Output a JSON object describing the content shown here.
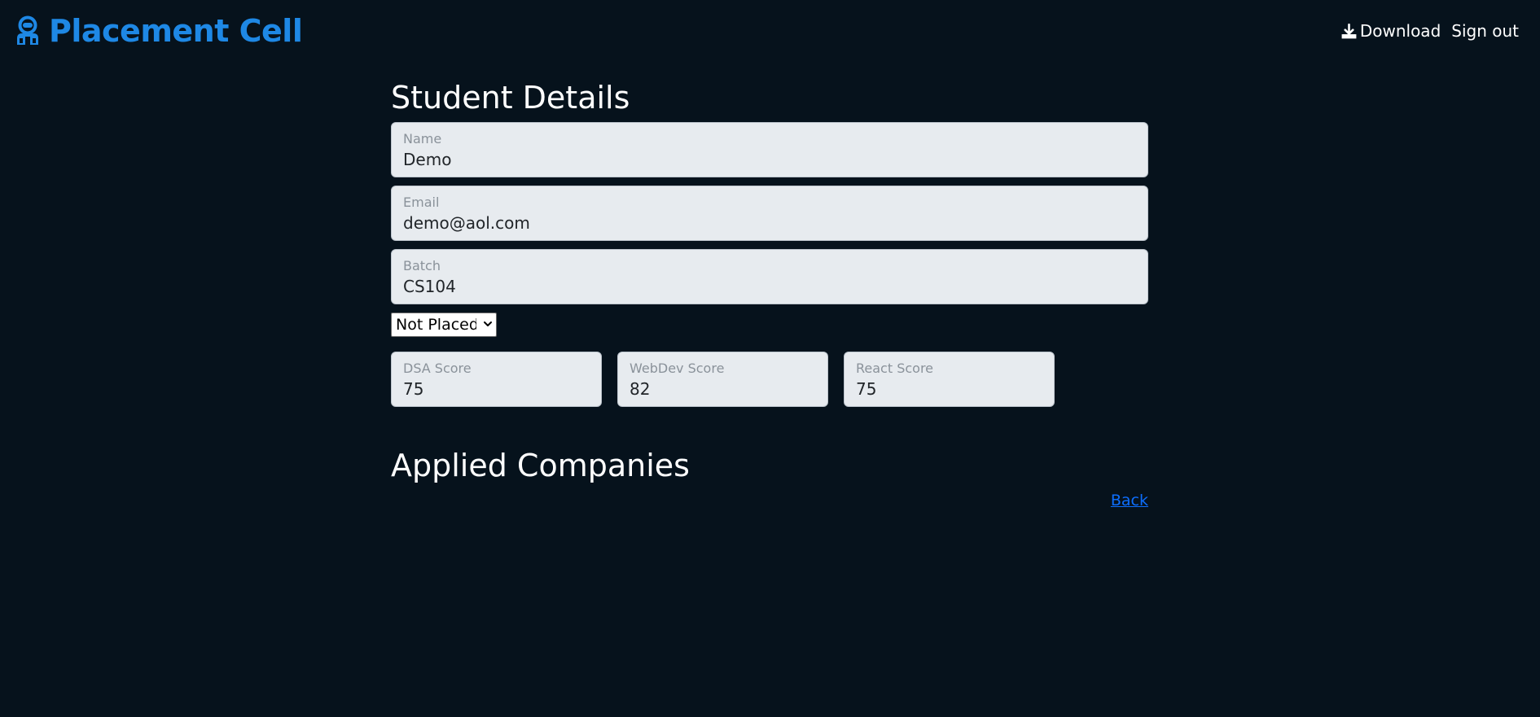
{
  "navbar": {
    "brand": "Placement Cell",
    "brand_icon": "robot-icon",
    "download_label": "Download",
    "download_icon": "download-icon",
    "signout_label": "Sign out"
  },
  "page": {
    "title": "Student Details"
  },
  "form": {
    "name": {
      "label": "Name",
      "value": "Demo"
    },
    "email": {
      "label": "Email",
      "value": "demo@aol.com"
    },
    "batch": {
      "label": "Batch",
      "value": "CS104"
    },
    "status": {
      "selected": "Not Placed"
    },
    "scores": {
      "dsa": {
        "label": "DSA Score",
        "value": "75"
      },
      "webdev": {
        "label": "WebDev Score",
        "value": "82"
      },
      "react": {
        "label": "React Score",
        "value": "75"
      }
    }
  },
  "companies": {
    "title": "Applied Companies"
  },
  "back_label": "Back",
  "colors": {
    "background": "#06121c",
    "brand": "#1e88e5",
    "field_bg": "#e7ebef",
    "link": "#0d6efd"
  }
}
